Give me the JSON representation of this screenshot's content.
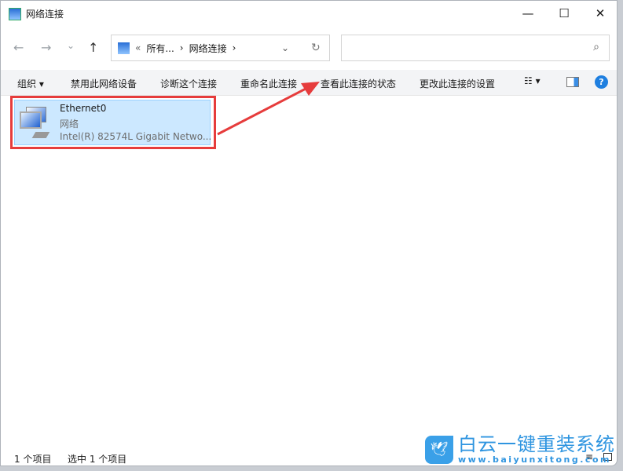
{
  "window": {
    "title": "网络连接",
    "minimize": "—",
    "maximize": "☐",
    "close": "✕"
  },
  "nav": {
    "back": "←",
    "forward": "→",
    "recent": "⌄",
    "up": "↑"
  },
  "address": {
    "prefix": "«",
    "crumbs": [
      "所有...",
      "网络连接"
    ],
    "sep": "›",
    "dropdown": "⌄",
    "refresh": "↻"
  },
  "search": {
    "placeholder": "",
    "icon": "⌕"
  },
  "toolbar": {
    "organize": "组织",
    "items": [
      "禁用此网络设备",
      "诊断这个连接",
      "重命名此连接",
      "查看此连接的状态",
      "更改此连接的设置"
    ],
    "help": "?"
  },
  "connection": {
    "name": "Ethernet0",
    "type": "网络",
    "adapter": "Intel(R) 82574L Gigabit Netwo..."
  },
  "status": {
    "count": "1 个项目",
    "selected": "选中 1 个项目"
  },
  "watermark": {
    "title": "白云一键重装系统",
    "url": "www.baiyunxitong.com"
  },
  "colors": {
    "highlight": "#e63c3c",
    "selection": "#cce8ff"
  }
}
